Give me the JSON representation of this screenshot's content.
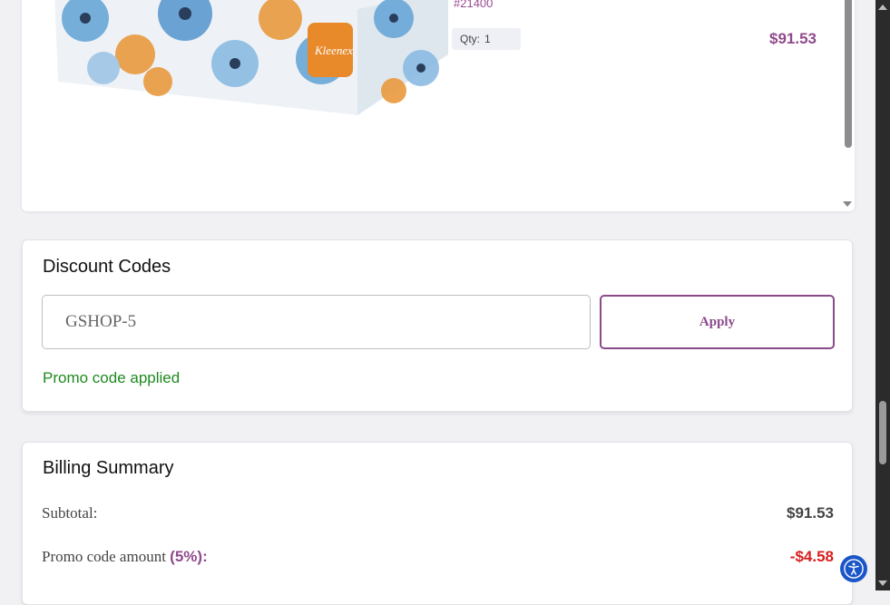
{
  "cart": {
    "sku": "#21400",
    "qty_label": "Qty:",
    "qty_value": "1",
    "price": "$91.53",
    "product_brand": "Kleenex"
  },
  "discount": {
    "title": "Discount Codes",
    "input_value": "GSHOP-5",
    "apply_label": "Apply",
    "status": "Promo code applied"
  },
  "billing": {
    "title": "Billing Summary",
    "subtotal_label": "Subtotal:",
    "subtotal_value": "$91.53",
    "promo_label": "Promo code amount",
    "promo_pct": "(5%):",
    "promo_value": "-$4.58"
  },
  "colors": {
    "accent": "#8b4a8a",
    "success": "#1f8a1f",
    "negative": "#d81e1e"
  },
  "icons": {
    "accessibility": "accessibility-icon"
  }
}
